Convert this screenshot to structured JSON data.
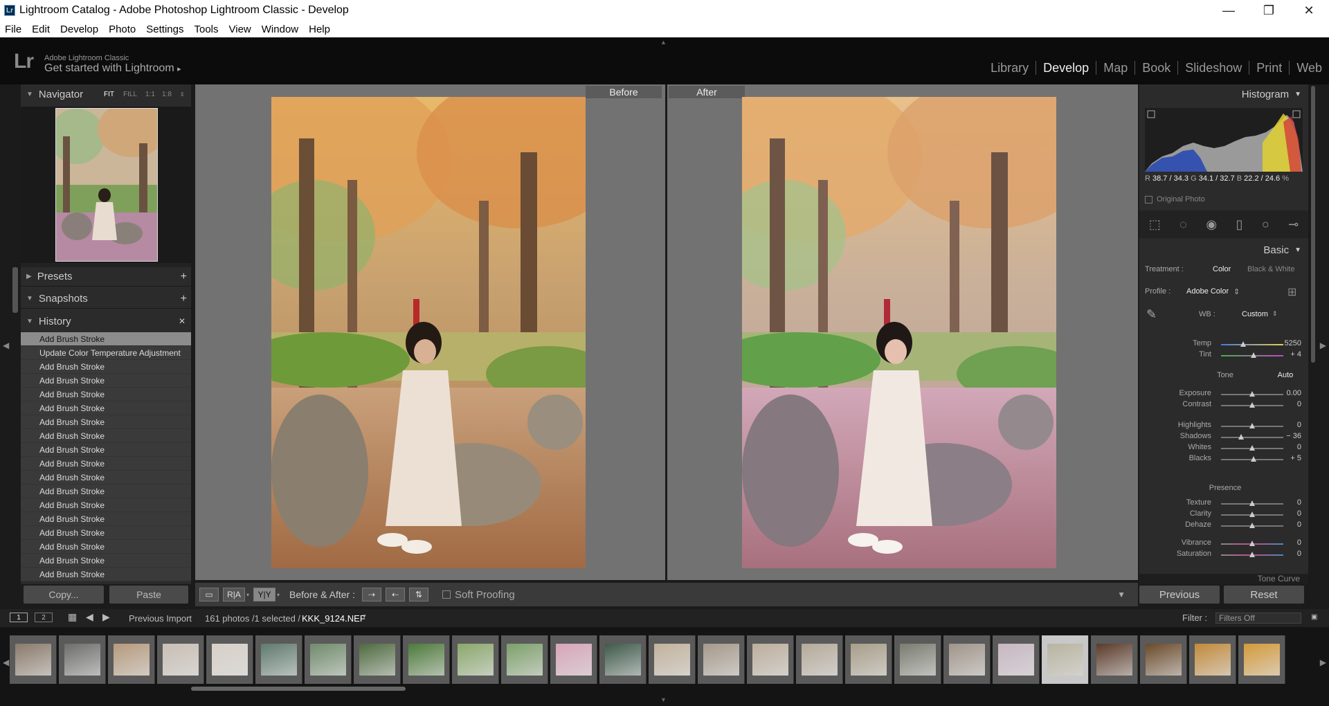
{
  "window": {
    "title": "Lightroom Catalog - Adobe Photoshop Lightroom Classic - Develop",
    "app_badge": "Lr"
  },
  "menu": [
    "File",
    "Edit",
    "Develop",
    "Photo",
    "Settings",
    "Tools",
    "View",
    "Window",
    "Help"
  ],
  "identity": {
    "logo": "Lr",
    "brand": "Adobe Lightroom Classic",
    "tagline": "Get started with Lightroom",
    "tagline_arrow": "▸"
  },
  "modules": [
    "Library",
    "Develop",
    "Map",
    "Book",
    "Slideshow",
    "Print",
    "Web"
  ],
  "active_module": "Develop",
  "navigator": {
    "title": "Navigator",
    "zoom_options": [
      "FIT",
      "FILL",
      "1:1",
      "1:8"
    ]
  },
  "presets": {
    "title": "Presets"
  },
  "snapshots": {
    "title": "Snapshots"
  },
  "history": {
    "title": "History",
    "items": [
      "Add Brush Stroke",
      "Update Color Temperature Adjustment",
      "Add Brush Stroke",
      "Add Brush Stroke",
      "Add Brush Stroke",
      "Add Brush Stroke",
      "Add Brush Stroke",
      "Add Brush Stroke",
      "Add Brush Stroke",
      "Add Brush Stroke",
      "Add Brush Stroke",
      "Add Brush Stroke",
      "Add Brush Stroke",
      "Add Brush Stroke",
      "Add Brush Stroke",
      "Add Brush Stroke",
      "Add Brush Stroke",
      "Add Brush Stroke"
    ],
    "selected_index": 0
  },
  "left_buttons": {
    "copy": "Copy...",
    "paste": "Paste"
  },
  "view": {
    "before_label": "Before",
    "after_label": "After"
  },
  "toolbar": {
    "before_after_label": "Before & After :",
    "soft_proofing": "Soft Proofing",
    "ra_label": "R|A",
    "yy_label": "Y|Y"
  },
  "histogram": {
    "title": "Histogram",
    "r_label": "R",
    "r_value": "38.7 / 34.3",
    "g_label": "G",
    "g_value": "34.1 / 32.7",
    "b_label": "B",
    "b_value": "22.2 / 24.6",
    "unit": "%",
    "original_photo": "Original Photo"
  },
  "basic": {
    "title": "Basic",
    "treatment_label": "Treatment :",
    "treatment_color": "Color",
    "treatment_bw": "Black & White",
    "profile_label": "Profile :",
    "profile_value": "Adobe Color",
    "wb_label": "WB :",
    "wb_value": "Custom",
    "tone_label": "Tone",
    "auto_label": "Auto",
    "presence_label": "Presence",
    "sliders": [
      {
        "label": "Temp",
        "value": "5250",
        "pos": 0.35
      },
      {
        "label": "Tint",
        "value": "+ 4",
        "pos": 0.52
      },
      {
        "label": "Exposure",
        "value": "0.00",
        "pos": 0.5
      },
      {
        "label": "Contrast",
        "value": "0",
        "pos": 0.5
      },
      {
        "label": "Highlights",
        "value": "0",
        "pos": 0.5
      },
      {
        "label": "Shadows",
        "value": "− 36",
        "pos": 0.32
      },
      {
        "label": "Whites",
        "value": "0",
        "pos": 0.5
      },
      {
        "label": "Blacks",
        "value": "+ 5",
        "pos": 0.52
      },
      {
        "label": "Texture",
        "value": "0",
        "pos": 0.5
      },
      {
        "label": "Clarity",
        "value": "0",
        "pos": 0.5
      },
      {
        "label": "Dehaze",
        "value": "0",
        "pos": 0.5
      },
      {
        "label": "Vibrance",
        "value": "0",
        "pos": 0.5
      },
      {
        "label": "Saturation",
        "value": "0",
        "pos": 0.5
      }
    ],
    "next_panel": "Tone Curve"
  },
  "right_buttons": {
    "previous": "Previous",
    "reset": "Reset"
  },
  "filmbar": {
    "source": "Previous Import",
    "count": "161 photos /1 selected /",
    "filename": "KKK_9124.NEF",
    "filter_label": "Filter :",
    "filter_value": "Filters Off",
    "screen1": "1",
    "screen2": "2"
  },
  "filmstrip": {
    "thumbs": [
      "#8a7a6a",
      "#6d6d6a",
      "#b59a7c",
      "#c9bfb4",
      "#d8d0c8",
      "#5f7a6e",
      "#6f8b6a",
      "#4e6a3f",
      "#4c7a3a",
      "#8aa86c",
      "#7ca06a",
      "#d7a5b8",
      "#3e5a4a",
      "#c2b29c",
      "#a5998a",
      "#bcae9c",
      "#b4aa9a",
      "#a89e88",
      "#7a7c70",
      "#a0958a",
      "#c7b7c2",
      "#b8b4a0",
      "#5a3a28",
      "#6a4a2a",
      "#c28a3a",
      "#d49a3a",
      "#5a4a3a"
    ],
    "selected_index": 21
  }
}
